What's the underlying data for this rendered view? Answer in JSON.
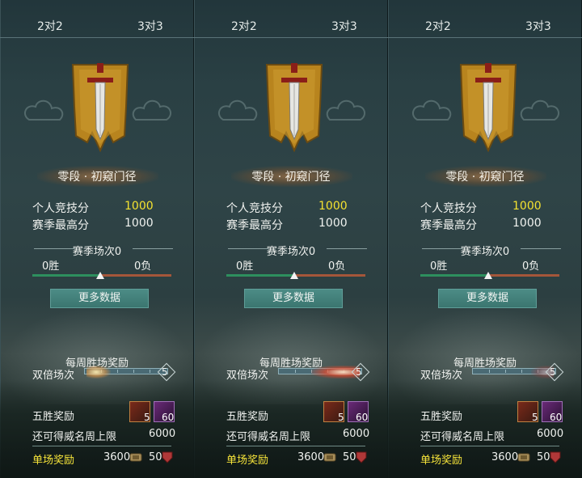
{
  "panels": [
    {
      "tabs": [
        "2对2",
        "3对3"
      ],
      "emblem": "sword-banner-icon",
      "rank_name": "零段 · 初窥门径",
      "personal_score_label": "个人竞技分",
      "personal_score": "1000",
      "season_high_label": "赛季最高分",
      "season_high": "1000",
      "season_matches": "赛季场次0",
      "wins": "0胜",
      "losses": "0负",
      "win_ratio": 0.5,
      "more_button": "更多数据",
      "weekly_title": "每周胜场奖励",
      "double_label": "双倍场次",
      "double_count": "5",
      "five_win_label": "五胜奖励",
      "item1_count": "5",
      "item2_count": "60",
      "cap_label": "还可得威名周上限",
      "cap_value": "6000",
      "single_label": "单场奖励",
      "single_reward1": "3600",
      "single_reward2": "50"
    },
    {
      "tabs": [
        "2对2",
        "3对3"
      ],
      "emblem": "sword-banner-icon",
      "rank_name": "零段 · 初窥门径",
      "personal_score_label": "个人竞技分",
      "personal_score": "1000",
      "season_high_label": "赛季最高分",
      "season_high": "1000",
      "season_matches": "赛季场次0",
      "wins": "0胜",
      "losses": "0负",
      "win_ratio": 0.5,
      "more_button": "更多数据",
      "weekly_title": "每周胜场奖励",
      "double_label": "双倍场次",
      "double_count": "5",
      "five_win_label": "五胜奖励",
      "item1_count": "5",
      "item2_count": "60",
      "cap_label": "还可得威名周上限",
      "cap_value": "6000",
      "single_label": "单场奖励",
      "single_reward1": "3600",
      "single_reward2": "50"
    },
    {
      "tabs": [
        "2对2",
        "3对3"
      ],
      "emblem": "sword-banner-icon",
      "rank_name": "零段 · 初窥门径",
      "personal_score_label": "个人竞技分",
      "personal_score": "1000",
      "season_high_label": "赛季最高分",
      "season_high": "1000",
      "season_matches": "赛季场次0",
      "wins": "0胜",
      "losses": "0负",
      "win_ratio": 0.5,
      "more_button": "更多数据",
      "weekly_title": "每周胜场奖励",
      "double_label": "双倍场次",
      "double_count": "5",
      "five_win_label": "五胜奖励",
      "item1_count": "5",
      "item2_count": "60",
      "cap_label": "还可得威名周上限",
      "cap_value": "6000",
      "single_label": "单场奖励",
      "single_reward1": "3600",
      "single_reward2": "50"
    }
  ],
  "colors": {
    "highlight_yellow": "#f4e230",
    "win_green": "#2d8f5e",
    "loss_red": "#a4563a",
    "button_teal": "#3b7670"
  }
}
